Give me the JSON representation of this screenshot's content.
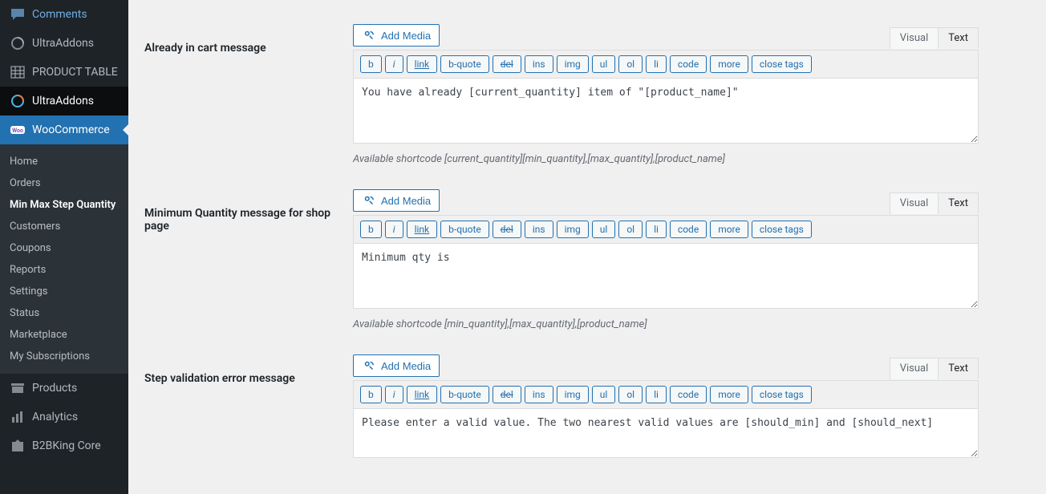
{
  "sidebar": {
    "items": [
      {
        "label": "Comments",
        "icon": "comment"
      },
      {
        "label": "UltraAddons",
        "icon": "spiral"
      },
      {
        "label": "PRODUCT TABLE",
        "icon": "table"
      },
      {
        "label": "UltraAddons",
        "icon": "spiral-highlight",
        "highlighted": true
      },
      {
        "label": "WooCommerce",
        "icon": "woo",
        "active": true
      }
    ],
    "submenu": [
      {
        "label": "Home"
      },
      {
        "label": "Orders"
      },
      {
        "label": "Min Max Step Quantity",
        "current": true
      },
      {
        "label": "Customers"
      },
      {
        "label": "Coupons"
      },
      {
        "label": "Reports"
      },
      {
        "label": "Settings"
      },
      {
        "label": "Status"
      },
      {
        "label": "Marketplace"
      },
      {
        "label": "My Subscriptions"
      }
    ],
    "bottom": [
      {
        "label": "Products",
        "icon": "archive"
      },
      {
        "label": "Analytics",
        "icon": "chart"
      },
      {
        "label": "B2BKing Core",
        "icon": "b2b"
      }
    ]
  },
  "editor": {
    "add_media": "Add Media",
    "tabs": {
      "visual": "Visual",
      "text": "Text"
    },
    "quicktags": {
      "b": "b",
      "i": "i",
      "link": "link",
      "bquote": "b-quote",
      "del": "del",
      "ins": "ins",
      "img": "img",
      "ul": "ul",
      "ol": "ol",
      "li": "li",
      "code": "code",
      "more": "more",
      "close": "close tags"
    }
  },
  "rows": [
    {
      "label": "Already in cart message",
      "value": "You have already [current_quantity] item of \"[product_name]\"",
      "hint": "Available shortcode [current_quantity][min_quantity],[max_quantity],[product_name]"
    },
    {
      "label": "Minimum Quantity message for shop page",
      "value": "Minimum qty is",
      "hint": "Available shortcode [min_quantity],[max_quantity],[product_name]"
    },
    {
      "label": "Step validation error message",
      "value": "Please enter a valid value. The two nearest valid values are [should_min] and [should_next]",
      "hint": ""
    }
  ]
}
